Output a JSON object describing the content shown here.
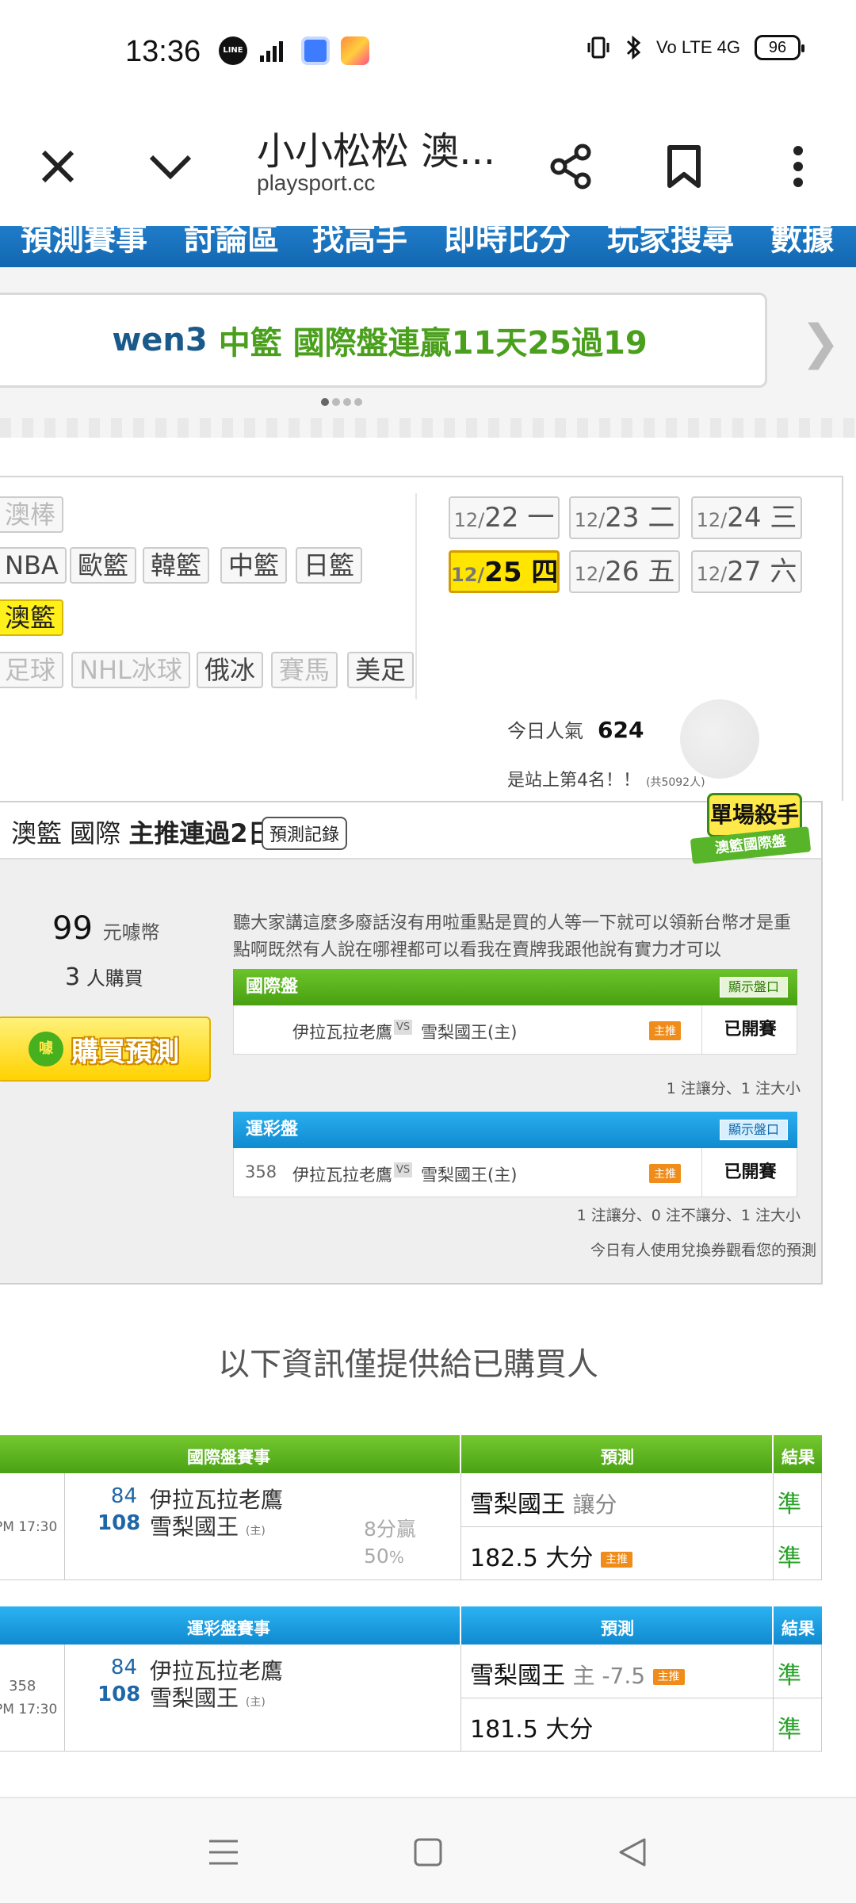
{
  "status_bar": {
    "time": "13:36",
    "line_label": "LINE",
    "network_right": "Vo LTE 4G",
    "battery": "96"
  },
  "browser": {
    "title": "小小松松 澳...",
    "url": "playsport.cc"
  },
  "nav": [
    "預測賽事",
    "討論區",
    "找高手",
    "即時比分",
    "玩家搜尋",
    "數據"
  ],
  "banner": {
    "user": "wen3",
    "text": "中籃 國際盤連贏11天25過19"
  },
  "sports": {
    "t1": "澳棒",
    "t2": "NBA",
    "t3": "歐籃",
    "t4": "韓籃",
    "t5": "中籃",
    "t6": "日籃",
    "t7": "澳籃",
    "t8": "足球",
    "t9": "NHL冰球",
    "t10": "俄冰",
    "t11": "賽馬",
    "t12": "美足"
  },
  "dates": [
    {
      "m": "12/",
      "d": "22 一"
    },
    {
      "m": "12/",
      "d": "23 二"
    },
    {
      "m": "12/",
      "d": "24 三"
    },
    {
      "m": "12/",
      "d": "25 四"
    },
    {
      "m": "12/",
      "d": "26 五"
    },
    {
      "m": "12/",
      "d": "27 六"
    }
  ],
  "popularity": {
    "label": "今日人氣",
    "value": "624",
    "rank_text": "是站上第4名！！",
    "rank_total": "(共5092人)"
  },
  "prediction": {
    "title_prefix": "澳籃 國際",
    "title_bold": "主推連過2日",
    "record_btn": "預測記錄",
    "badge_main": "單場殺手",
    "badge_sub": "澳籃國際盤",
    "price": "99",
    "price_unit": "元噱幣",
    "buyers": "3",
    "buyers_unit": "人購買",
    "buy_btn": "購買預測",
    "coin": "噱",
    "description": "聽大家講這麼多廢話沒有用啦重點是買的人等一下就可以領新台幣才是重點啊既然有人說在哪裡都可以看我在賣牌我跟他說有實力才可以",
    "intl": {
      "header": "國際盤",
      "show_btn": "顯示盤口",
      "num": "",
      "away": "伊拉瓦拉老鷹",
      "vs": "VS",
      "home": "雪梨國王(主)",
      "rec": "主推",
      "status": "已開賽",
      "note": "1 注讓分、1 注大小"
    },
    "lottery": {
      "header": "運彩盤",
      "show_btn": "顯示盤口",
      "num": "358",
      "away": "伊拉瓦拉老鷹",
      "vs": "VS",
      "home": "雪梨國王(主)",
      "rec": "主推",
      "status": "已開賽",
      "note": "1 注讓分、0 注不讓分、1 注大小"
    },
    "ticket_note": "今日有人使用兌換券觀看您的預測"
  },
  "info_title": "以下資訊僅提供給已購買人",
  "intl_table": {
    "h_game": "國際盤賽事",
    "h_pred": "預測",
    "h_result": "結果",
    "time": "PM 17:30",
    "away_score": "84",
    "away_team": "伊拉瓦拉老鷹",
    "home_score": "108",
    "home_team": "雪梨國王",
    "home_mark": "(主)",
    "margin": "8分贏",
    "margin_pct": "50",
    "pct_sign": "%",
    "pick1_team": "雪梨國王",
    "pick1_sub": "讓分",
    "pick1_result": "準",
    "pick2": "182.5 大分",
    "pick2_rec": "主推",
    "pick2_result": "準"
  },
  "lottery_table": {
    "h_game": "運彩盤賽事",
    "h_pred": "預測",
    "h_result": "結果",
    "num": "358",
    "time": "PM 17:30",
    "away_score": "84",
    "away_team": "伊拉瓦拉老鷹",
    "home_score": "108",
    "home_team": "雪梨國王",
    "home_mark": "(主)",
    "pick1_team": "雪梨國王",
    "pick1_sub": "主 -7.5",
    "pick1_rec": "主推",
    "pick1_result": "準",
    "pick2": "181.5 大分",
    "pick2_result": "準"
  }
}
